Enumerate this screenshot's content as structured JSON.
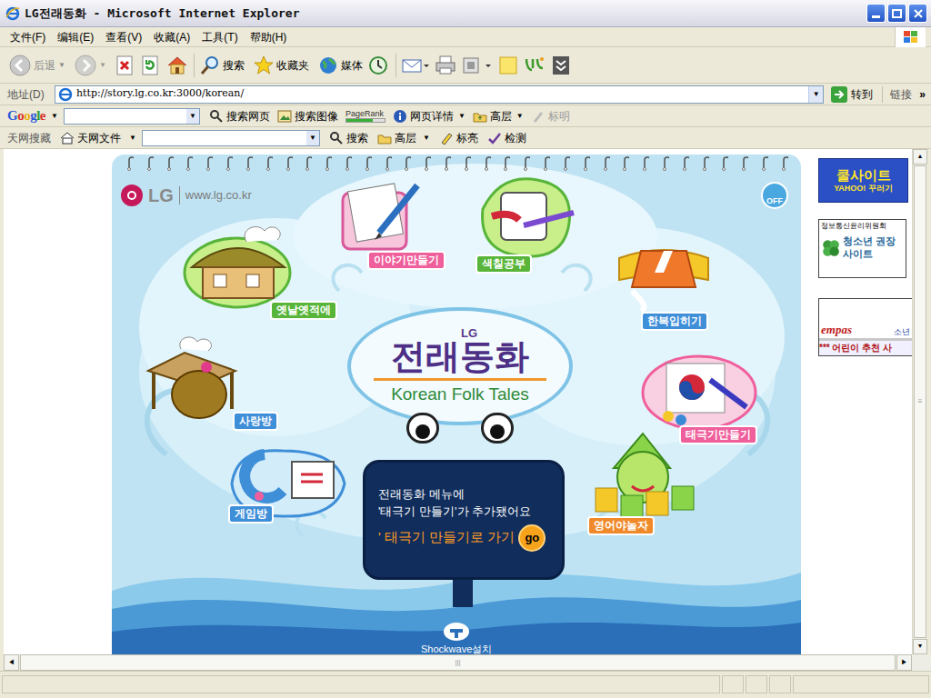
{
  "window": {
    "title": "LG전래동화 - Microsoft Internet Explorer"
  },
  "menu": [
    "文件(F)",
    "编辑(E)",
    "查看(V)",
    "收藏(A)",
    "工具(T)",
    "帮助(H)"
  ],
  "toolbar": {
    "back": {
      "label": "后退",
      "disabled": true
    },
    "forward": {
      "disabled": true
    },
    "search": "搜索",
    "favorites": "收藏夹",
    "media": "媒体"
  },
  "address": {
    "label": "地址(D)",
    "url": "http://story.lg.co.kr:3000/korean/",
    "go": "转到",
    "links": "链接",
    "more": "»"
  },
  "google_bar": {
    "logo": "Google",
    "pagerank": {
      "label": "PageRank",
      "level": 0.7
    },
    "buttons": [
      {
        "label": "搜索网页",
        "disabled": false
      },
      {
        "label": "搜索图像",
        "disabled": false
      },
      {
        "label": "网页详情",
        "disabled": false
      },
      {
        "label": "高层",
        "disabled": false
      },
      {
        "label": "标明",
        "disabled": true
      }
    ]
  },
  "tianwang_bar": {
    "label": "天网搜藏",
    "file": "天网文件",
    "buttons": [
      "搜索",
      "高层",
      "标亮",
      "检测"
    ]
  },
  "page": {
    "lg_logo": "LG",
    "site": "www.lg.co.kr",
    "sound": "OFF",
    "title_small": "LG",
    "title": "전래동화",
    "subtitle": "Korean Folk Tales",
    "menu": [
      "이야기만들기",
      "색칠공부",
      "옛날옛적에",
      "한복입히기",
      "사랑방",
      "태극기만들기",
      "게임방",
      "영어야놀자"
    ],
    "notice": {
      "line1": "전래동화 메뉴에",
      "line2": "'태극기 만들기'가 추가됐어요",
      "link": "' 태극기 만들기로 가기",
      "go": "go"
    },
    "shockwave": "Shockwave설치"
  },
  "ads": {
    "yahoo": {
      "title": "쿨사이트",
      "sub": "YAHOO! 꾸러기"
    },
    "kiss": {
      "top": "정보통신윤리위원회",
      "title": "청소년 권장사이트"
    },
    "empas": {
      "logo": "empas",
      "side": "소년",
      "bottom": "*** 어린이 추천 사"
    }
  }
}
